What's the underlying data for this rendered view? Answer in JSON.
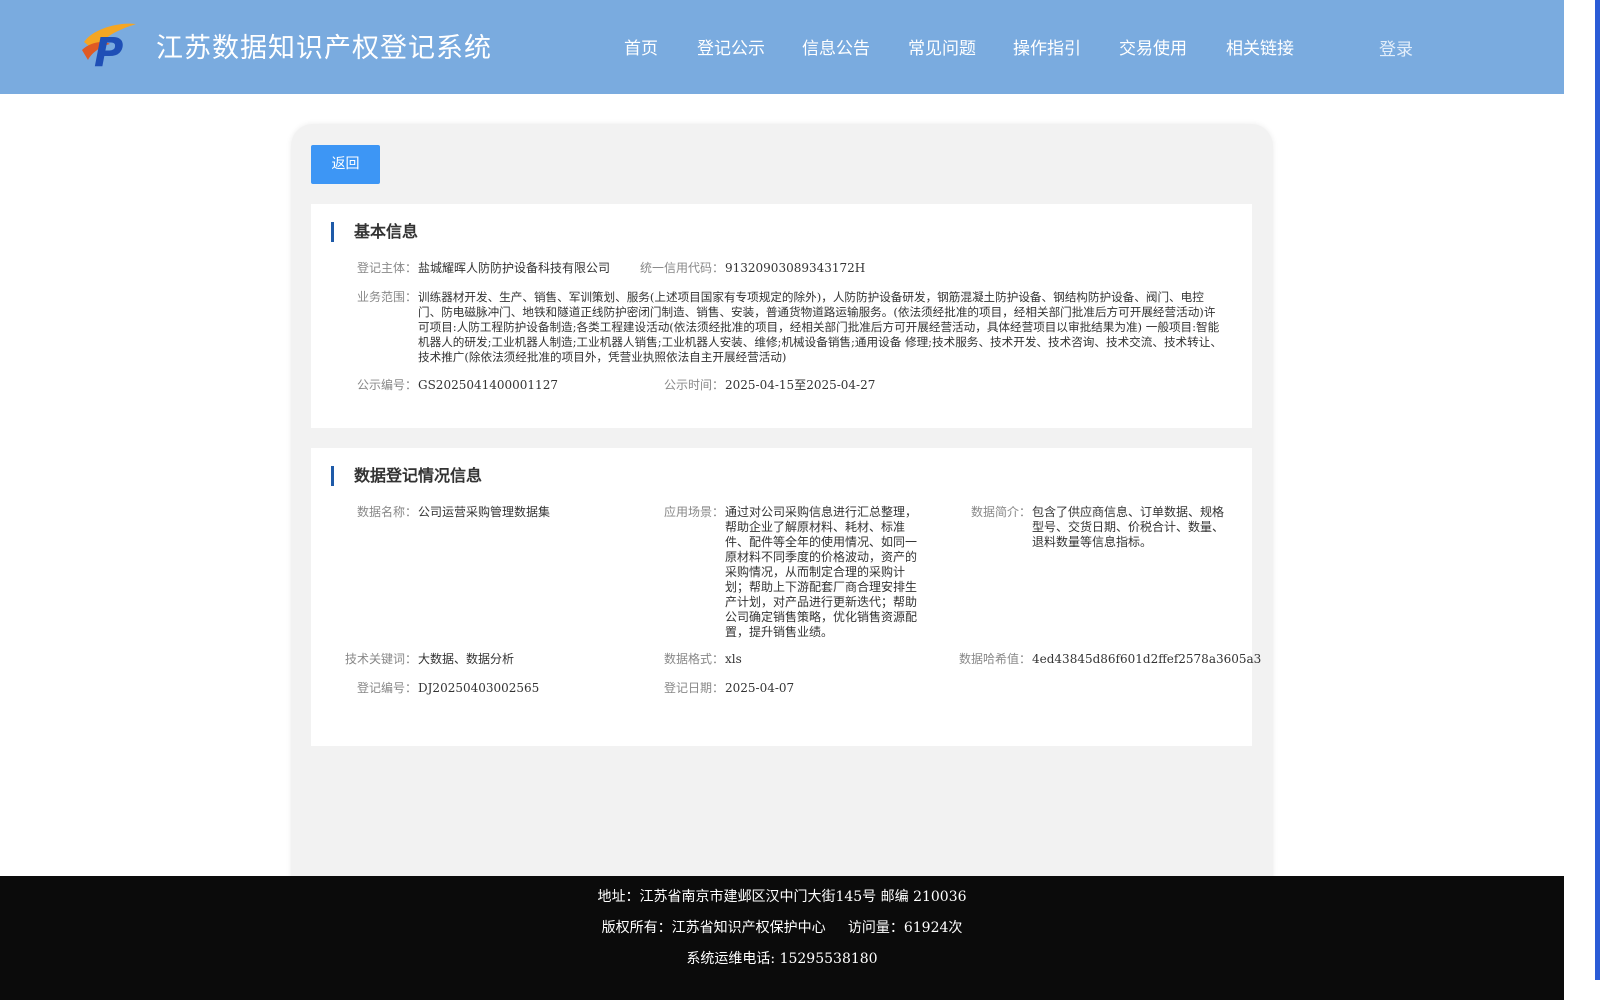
{
  "header": {
    "title": "江苏数据知识产权登记系统",
    "nav": [
      "首页",
      "登记公示",
      "信息公告",
      "常见问题",
      "操作指引",
      "交易使用",
      "相关链接"
    ],
    "login": "登录",
    "logo_letter": "P"
  },
  "back_label": "返回",
  "basic": {
    "title": "基本信息",
    "subject_label": "登记主体：",
    "subject": "盐城耀晖人防防护设备科技有限公司",
    "credit_label": "统一信用代码：",
    "credit": "91320903089343172H",
    "scope_label": "业务范围：",
    "scope_lines": [
      "训练器材开发、生产、销售、军训策划、服务(上述项目国家有专项规定的除外)，人防防护设备研发，钢筋混凝土防护设备、钢结构防护设备、阀门、电控",
      "门、防电磁脉冲门、地铁和隧道正线防护密闭门制造、销售、安装，普通货物道路运输服务。(依法须经批准的项目，经相关部门批准后方可开展经营活动)许",
      "可项目:人防工程防护设备制造;各类工程建设活动(依法须经批准的项目，经相关部门批准后方可开展经营活动，具体经营项目以审批结果为准) 一般项目:智能",
      "机器人的研发;工业机器人制造;工业机器人销售;工业机器人安装、维修;机械设备销售;通用设备 修理;技术服务、技术开发、技术咨询、技术交流、技术转让、",
      "技术推广(除依法须经批准的项目外，凭营业执照依法自主开展经营活动)"
    ],
    "pub_no_label": "公示编号：",
    "pub_no": "GS2025041400001127",
    "pub_time_label": "公示时间：",
    "pub_time": "2025-04-15至2025-04-27"
  },
  "data_info": {
    "title": "数据登记情况信息",
    "name_label": "数据名称：",
    "name": "公司运营采购管理数据集",
    "scene_label": "应用场景：",
    "scene_lines": [
      "通过对公司采购信息进行汇总整理，",
      "帮助企业了解原材料、耗材、标准",
      "件、配件等全年的使用情况、如同一",
      "原材料不同季度的价格波动，资产的",
      "采购情况，从而制定合理的采购计",
      "划；帮助上下游配套厂商合理安排生",
      "产计划，对产品进行更新迭代；帮助",
      "公司确定销售策略，优化销售资源配",
      "置，提升销售业绩。"
    ],
    "intro_label": "数据简介：",
    "intro_lines": [
      "包含了供应商信息、订单数据、规格",
      "型号、交货日期、价税合计、数量、",
      "退料数量等信息指标。"
    ],
    "keywords_label": "技术关键词：",
    "keywords": "大数据、数据分析",
    "format_label": "数据格式：",
    "format": "xls",
    "hash_label": "数据哈希值：",
    "hash": "4ed43845d86f601d2ffef2578a3605a3",
    "reg_no_label": "登记编号：",
    "reg_no": "DJ20250403002565",
    "reg_date_label": "登记日期：",
    "reg_date": "2025-04-07"
  },
  "footer": {
    "address": "地址：江苏省南京市建邺区汉中门大街145号 邮编 210036",
    "copyright": "版权所有：江苏省知识产权保护中心     访问量：61924次",
    "phone": "系统运维电话: 15295538180"
  },
  "colors": {
    "header_bg": "#7aabdf",
    "button_bg": "#3d96f5",
    "title_bar": "#1e5aa8",
    "footer_bg": "#0b0b0b"
  }
}
